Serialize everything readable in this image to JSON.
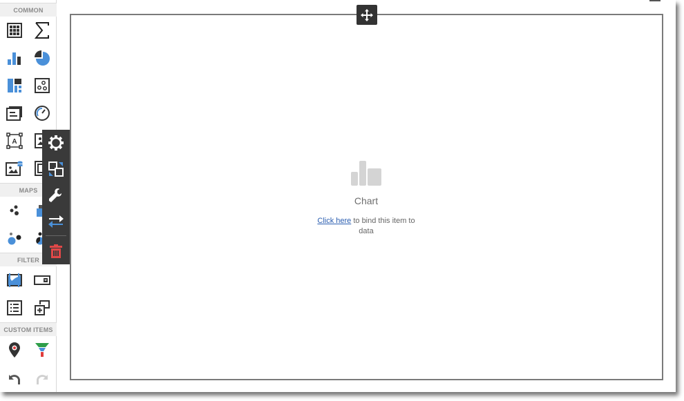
{
  "toolbox": {
    "groups": [
      {
        "label": "COMMON"
      },
      {
        "label": "MAPS"
      },
      {
        "label": "FILTER"
      },
      {
        "label": "CUSTOM ITEMS"
      }
    ],
    "items": {
      "grid": "Grid",
      "cards": "Cards",
      "chart": "Chart",
      "pie": "Pies",
      "treemap": "Treemap",
      "scatter_chart": "Scatter Chart",
      "text_box": "Text Box",
      "gauges": "Gauges",
      "bound_image": "Bound Image",
      "image": "Image",
      "bound_image_db": "Bound Image (data)",
      "group": "Group",
      "geo_point_map": "Geo Point Map",
      "choropleth_map": "Choropleth Map",
      "bubble_map": "Bubble Map",
      "pie_map": "Pie Map",
      "range_filter": "Range Filter",
      "combo_box": "Combo Box",
      "list_box": "List Box",
      "tree_view": "Tree View",
      "custom_map": "Custom Map",
      "funnel": "Funnel"
    },
    "undo": "Undo",
    "redo": "Redo"
  },
  "dashboard_item": {
    "type": "Chart",
    "placeholder_title": "Chart",
    "bind_link": "Click here",
    "bind_text": " to bind this item to data"
  },
  "context_menu": {
    "items": [
      "Options",
      "Convert",
      "Properties",
      "Swap",
      "Delete"
    ]
  },
  "colors": {
    "accent_blue": "#4a90d9",
    "delete_red": "#e04848",
    "menu_bg": "#3a3a3a",
    "funnel_green": "#2e9e4a",
    "funnel_red": "#e03c3c"
  }
}
